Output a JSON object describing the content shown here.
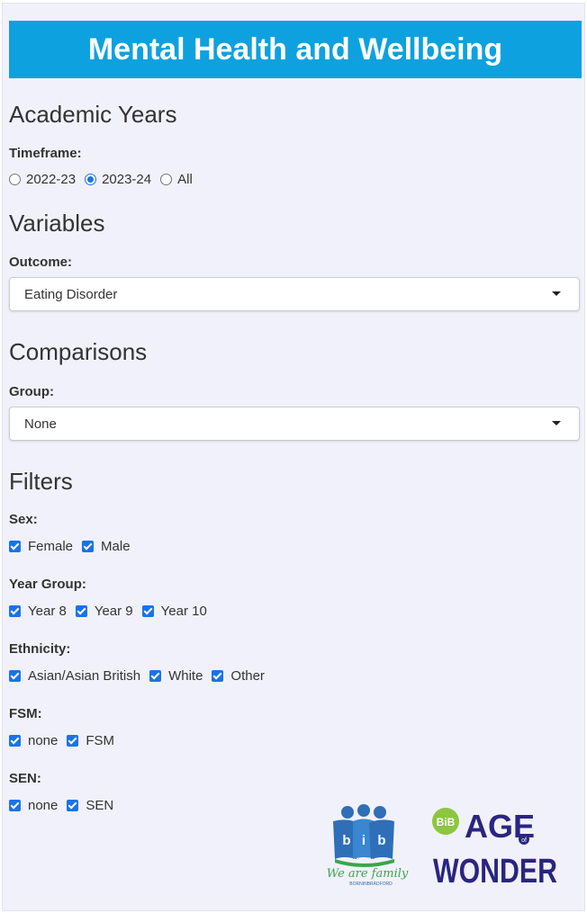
{
  "header": {
    "title": "Mental Health and Wellbeing"
  },
  "academic": {
    "heading": "Academic Years",
    "label": "Timeframe:",
    "options": [
      "2022-23",
      "2023-24",
      "All"
    ],
    "selected": "2023-24"
  },
  "variables": {
    "heading": "Variables",
    "label": "Outcome:",
    "value": "Eating Disorder"
  },
  "comparisons": {
    "heading": "Comparisons",
    "label": "Group:",
    "value": "None"
  },
  "filters": {
    "heading": "Filters",
    "sex": {
      "label": "Sex:",
      "options": [
        "Female",
        "Male"
      ]
    },
    "year_group": {
      "label": "Year Group:",
      "options": [
        "Year 8",
        "Year 9",
        "Year 10"
      ]
    },
    "ethnicity": {
      "label": "Ethnicity:",
      "options": [
        "Asian/Asian British",
        "White",
        "Other"
      ]
    },
    "fsm": {
      "label": "FSM:",
      "options": [
        "none",
        "FSM"
      ]
    },
    "sen": {
      "label": "SEN:",
      "options": [
        "none",
        "SEN"
      ]
    }
  },
  "logos": {
    "bib": {
      "letters": [
        "b",
        "i",
        "b"
      ],
      "tagline": "We are family",
      "subtitle": "BORNINBRADFORD"
    },
    "age_of_wonder": {
      "badge": "BiB",
      "line1": "AGE",
      "of": "of",
      "line2": "WONDER"
    }
  },
  "colors": {
    "accent": "#0ea1df",
    "checkbox": "#1a73e8",
    "panel": "#f1f1fb"
  }
}
